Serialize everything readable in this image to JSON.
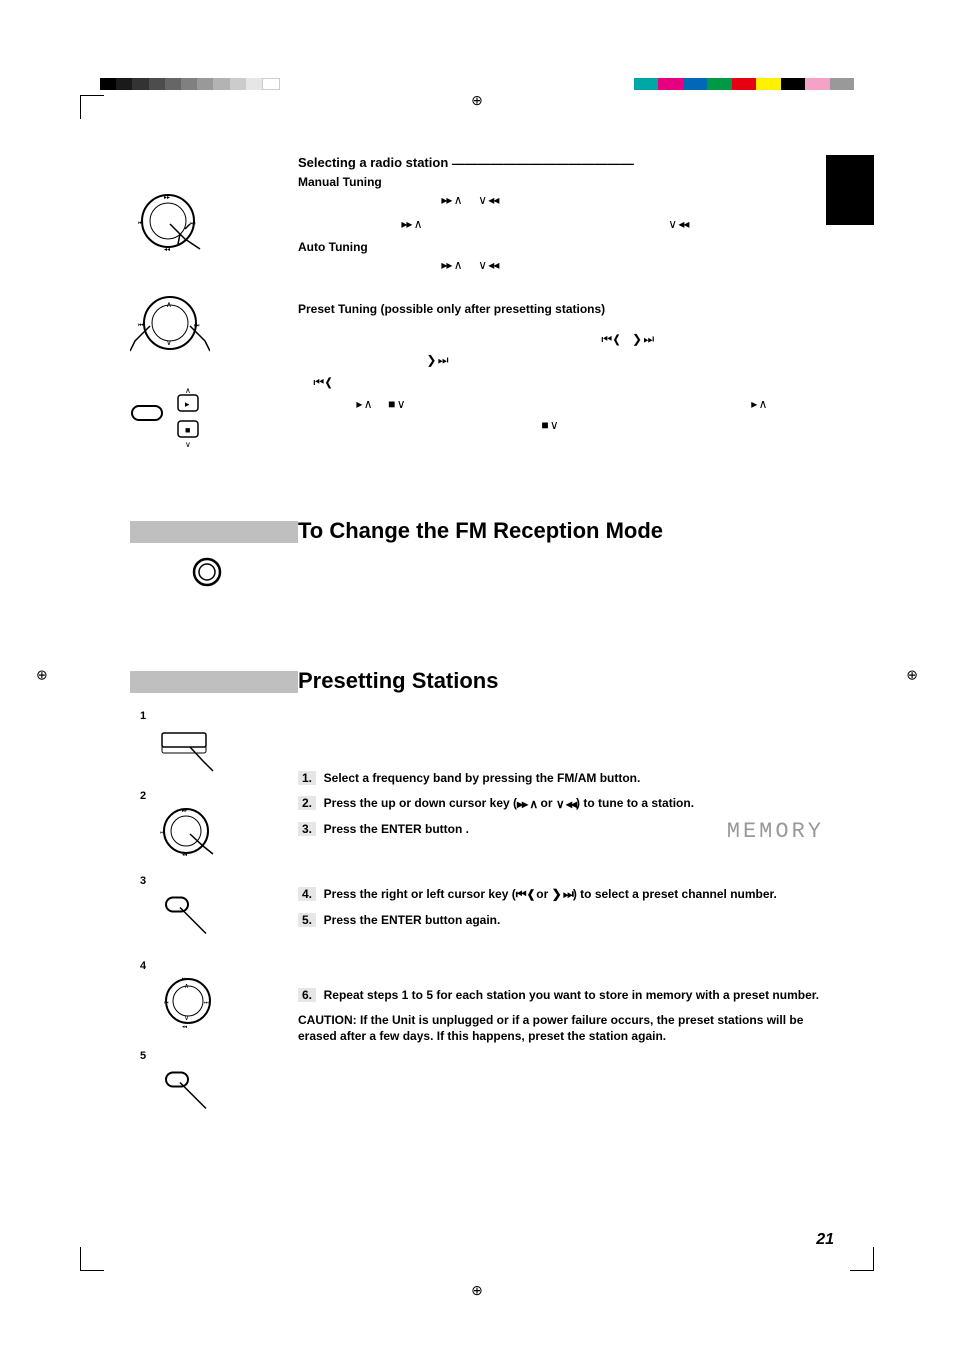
{
  "sections": {
    "selecting": {
      "title": "Selecting a radio station",
      "divider": "——————————————",
      "manual_tuning_label": "Manual Tuning",
      "auto_tuning_label": "Auto Tuning",
      "preset_tuning_label": "Preset Tuning  (possible only after presetting stations)"
    },
    "fm_mode": {
      "heading": "To Change the FM Reception Mode"
    },
    "presetting": {
      "heading": "Presetting Stations",
      "steps": {
        "s1_num": "1.",
        "s1_text": "Select a frequency band by pressing the FM/AM button.",
        "s2_num": "2.",
        "s2_text_a": "Press the up or down cursor key (",
        "s2_text_b": " or ",
        "s2_text_c": ") to tune to a station.",
        "s3_num": "3.",
        "s3_text": "Press the ENTER button .",
        "s4_num": "4.",
        "s4_text_a": "Press the right or left cursor key (",
        "s4_text_b": " or ",
        "s4_text_c": ") to select a preset channel number.",
        "s5_num": "5.",
        "s5_text": "Press the ENTER button again.",
        "s6_num": "6.",
        "s6_text": "Repeat steps 1 to 5 for each station you want to store in memory with a preset number."
      },
      "memory_display": "MEMORY",
      "caution": "CAUTION: If the Unit is unplugged or if a power failure occurs, the preset stations will be erased after a few days. If this happens, preset the station again."
    },
    "left_labels": {
      "n1": "1",
      "n2": "2",
      "n3": "3",
      "n4": "4",
      "n5": "5"
    }
  },
  "glyphs": {
    "ff_up": "▸▸ ∧",
    "down_rw": "∨ ◂◂",
    "prev_left": "⏮ ❮",
    "right_next": "❯ ⏭",
    "play_up": "▸ ∧",
    "stop_down": "■ ∨"
  },
  "page_number": "21"
}
